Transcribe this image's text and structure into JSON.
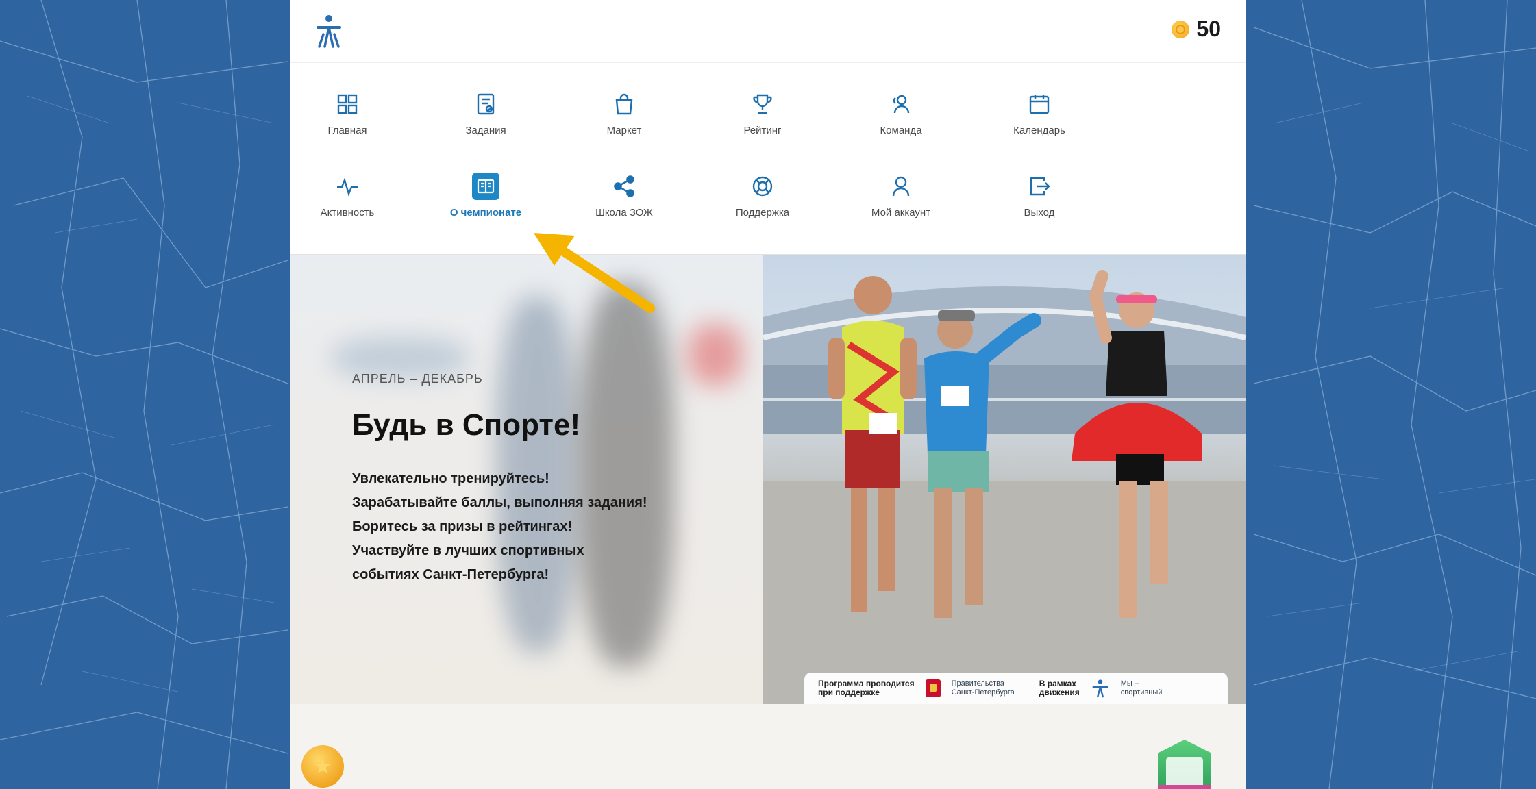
{
  "header": {
    "coins": "50"
  },
  "nav": {
    "items": [
      {
        "label": "Главная",
        "icon": "grid-icon"
      },
      {
        "label": "Задания",
        "icon": "tasks-icon"
      },
      {
        "label": "Маркет",
        "icon": "shopping-bag-icon"
      },
      {
        "label": "Рейтинг",
        "icon": "trophy-icon"
      },
      {
        "label": "Команда",
        "icon": "team-icon"
      },
      {
        "label": "Календарь",
        "icon": "calendar-icon"
      },
      {
        "label": "Активность",
        "icon": "activity-icon"
      },
      {
        "label": "О чемпионате",
        "icon": "book-icon",
        "active": true
      },
      {
        "label": "Школа ЗОЖ",
        "icon": "share-icon"
      },
      {
        "label": "Поддержка",
        "icon": "lifebuoy-icon"
      },
      {
        "label": "Мой аккаунт",
        "icon": "user-icon"
      },
      {
        "label": "Выход",
        "icon": "logout-icon"
      }
    ]
  },
  "hero": {
    "eyebrow": "АПРЕЛЬ – ДЕКАБРЬ",
    "title": "Будь в Спорте!",
    "lines": [
      "Увлекательно тренируйтесь!",
      "Зарабатывайте баллы, выполняя задания!",
      "Боритесь за призы в рейтингах!",
      "Участвуйте в лучших спортивных",
      "событиях Санкт-Петербурга!"
    ]
  },
  "sponsor": {
    "program_line1": "Программа проводится",
    "program_line2": "при поддержке",
    "gov_line1": "Правительства",
    "gov_line2": "Санкт-Петербурга",
    "movement_line1": "В рамках",
    "movement_line2": "движения",
    "movement_name": "Мы – спортивный"
  },
  "colors": {
    "accent": "#1e88c6",
    "map_bg": "#2e64a0",
    "arrow": "#f4b400"
  }
}
